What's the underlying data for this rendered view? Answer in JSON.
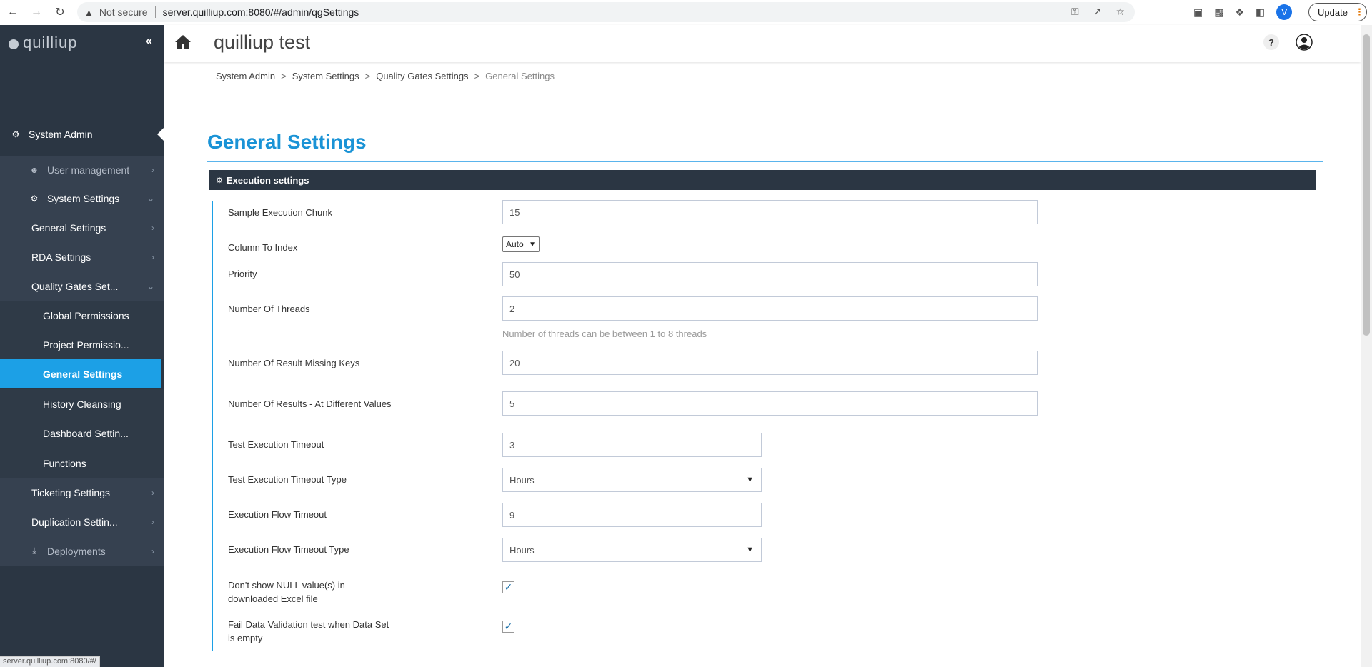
{
  "browser": {
    "not_secure": "Not secure",
    "url": "server.quilliup.com:8080/#/admin/qgSettings",
    "update_label": "Update",
    "profile_initial": "V",
    "status_url": "server.quilliup.com:8080/#/"
  },
  "app": {
    "logo_text": "quilliup",
    "title": "quilliup test"
  },
  "sidebar": {
    "system_admin": "System Admin",
    "user_management": "User management",
    "system_settings": "System Settings",
    "general_settings": "General Settings",
    "rda_settings": "RDA Settings",
    "quality_gates": "Quality Gates Set...",
    "global_permissions": "Global Permissions",
    "project_permissions": "Project Permissio...",
    "general_settings_active": "General Settings",
    "history_cleansing": "History Cleansing",
    "dashboard_settings": "Dashboard Settin...",
    "functions": "Functions",
    "ticketing_settings": "Ticketing Settings",
    "duplication_settings": "Duplication Settin...",
    "deployments": "Deployments"
  },
  "breadcrumb": [
    "System Admin",
    "System Settings",
    "Quality Gates Settings",
    "General Settings"
  ],
  "page": {
    "title": "General Settings",
    "section_title": "Execution settings"
  },
  "fields": {
    "sample_chunk_label": "Sample Execution Chunk",
    "sample_chunk_value": "15",
    "column_index_label": "Column To Index",
    "column_index_value": "Auto",
    "priority_label": "Priority",
    "priority_value": "50",
    "threads_label": "Number Of Threads",
    "threads_value": "2",
    "threads_help": "Number of threads can be between 1 to 8 threads",
    "missing_keys_label": "Number Of Result Missing Keys",
    "missing_keys_value": "20",
    "diff_values_label": "Number Of Results - At Different Values",
    "diff_values_value": "5",
    "test_timeout_label": "Test Execution Timeout",
    "test_timeout_value": "3",
    "test_timeout_type_label": "Test Execution Timeout Type",
    "test_timeout_type_value": "Hours",
    "flow_timeout_label": "Execution Flow Timeout",
    "flow_timeout_value": "9",
    "flow_timeout_type_label": "Execution Flow Timeout Type",
    "flow_timeout_type_value": "Hours",
    "null_excel_label_1": "Don't show NULL value(s) in",
    "null_excel_label_2": "downloaded Excel file",
    "null_excel_checked": true,
    "fail_empty_label_1": "Fail Data Validation test when Data Set",
    "fail_empty_label_2": "is empty",
    "fail_empty_checked": true
  },
  "colors": {
    "accent": "#1ca0e6",
    "sidebar_bg": "#2b3643",
    "title_blue": "#1a93d6"
  }
}
